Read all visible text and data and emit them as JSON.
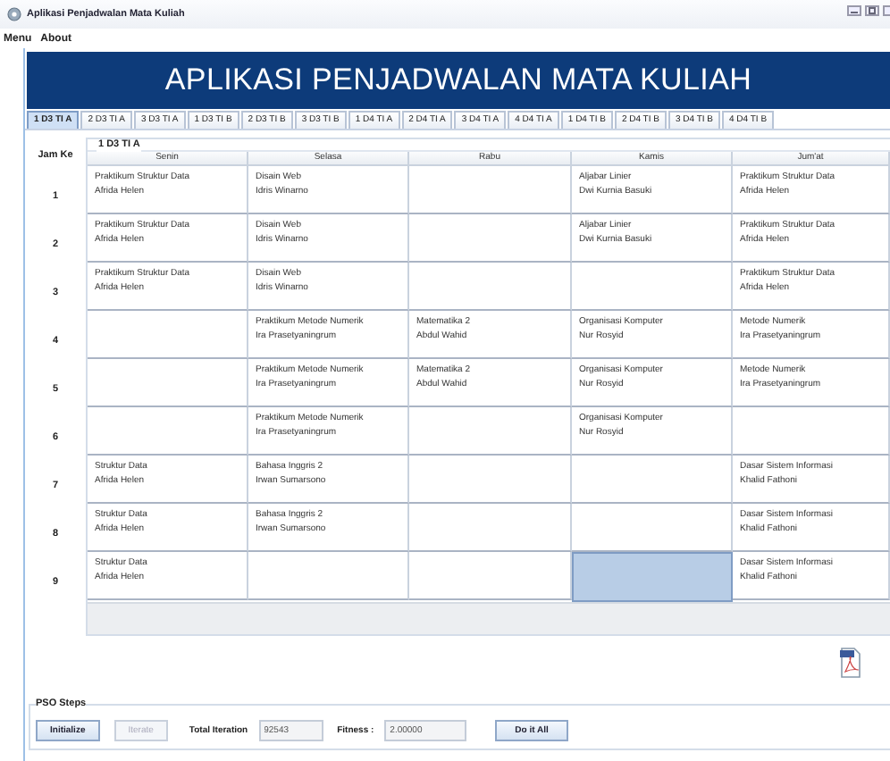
{
  "window": {
    "title": "Aplikasi Penjadwalan Mata Kuliah"
  },
  "menu": [
    {
      "label": "Menu"
    },
    {
      "label": "About"
    }
  ],
  "banner": {
    "title": "APLIKASI PENJADWALAN MATA KULIAH"
  },
  "tabs": [
    {
      "label": "1 D3 TI A",
      "selected": true
    },
    {
      "label": "2 D3 TI A",
      "selected": false
    },
    {
      "label": "3 D3 TI A",
      "selected": false
    },
    {
      "label": "1 D3 TI B",
      "selected": false
    },
    {
      "label": "2 D3 TI B",
      "selected": false
    },
    {
      "label": "3 D3 TI B",
      "selected": false
    },
    {
      "label": "1 D4 TI A",
      "selected": false
    },
    {
      "label": "2 D4 TI A",
      "selected": false
    },
    {
      "label": "3 D4 TI A",
      "selected": false
    },
    {
      "label": "4 D4 TI A",
      "selected": false
    },
    {
      "label": "1 D4 TI B",
      "selected": false
    },
    {
      "label": "2 D4 TI B",
      "selected": false
    },
    {
      "label": "3 D4 TI B",
      "selected": false
    },
    {
      "label": "4 D4 TI B",
      "selected": false
    }
  ],
  "schedule": {
    "hour_header": "Jam Ke",
    "group_title": "1 D3 TI A",
    "columns": [
      "Senin",
      "Selasa",
      "Rabu",
      "Kamis",
      "Jum'at"
    ],
    "rows": [
      {
        "hour": "1",
        "cells": [
          {
            "course": "Praktikum Struktur Data",
            "lecturer": "Afrida Helen",
            "selected": false
          },
          {
            "course": "Disain Web",
            "lecturer": "Idris Winarno",
            "selected": false
          },
          {
            "selected": false
          },
          {
            "course": "Aljabar Linier",
            "lecturer": "Dwi Kurnia Basuki",
            "selected": false
          },
          {
            "course": "Praktikum Struktur Data",
            "lecturer": "Afrida Helen",
            "selected": false
          }
        ]
      },
      {
        "hour": "2",
        "cells": [
          {
            "course": "Praktikum Struktur Data",
            "lecturer": "Afrida Helen",
            "selected": false
          },
          {
            "course": "Disain Web",
            "lecturer": "Idris Winarno",
            "selected": false
          },
          {
            "selected": false
          },
          {
            "course": "Aljabar Linier",
            "lecturer": "Dwi Kurnia Basuki",
            "selected": false
          },
          {
            "course": "Praktikum Struktur Data",
            "lecturer": "Afrida Helen",
            "selected": false
          }
        ]
      },
      {
        "hour": "3",
        "cells": [
          {
            "course": "Praktikum Struktur Data",
            "lecturer": "Afrida Helen",
            "selected": false
          },
          {
            "course": "Disain Web",
            "lecturer": "Idris Winarno",
            "selected": false
          },
          {
            "selected": false
          },
          {
            "selected": false
          },
          {
            "course": "Praktikum Struktur Data",
            "lecturer": "Afrida Helen",
            "selected": false
          }
        ]
      },
      {
        "hour": "4",
        "cells": [
          {
            "selected": false
          },
          {
            "course": "Praktikum Metode Numerik",
            "lecturer": "Ira Prasetyaningrum",
            "selected": false
          },
          {
            "course": "Matematika 2",
            "lecturer": "Abdul Wahid",
            "selected": false
          },
          {
            "course": "Organisasi Komputer",
            "lecturer": "Nur Rosyid",
            "selected": false
          },
          {
            "course": "Metode Numerik",
            "lecturer": "Ira Prasetyaningrum",
            "selected": false
          }
        ]
      },
      {
        "hour": "5",
        "cells": [
          {
            "selected": false
          },
          {
            "course": "Praktikum Metode Numerik",
            "lecturer": "Ira Prasetyaningrum",
            "selected": false
          },
          {
            "course": "Matematika 2",
            "lecturer": "Abdul Wahid",
            "selected": false
          },
          {
            "course": "Organisasi Komputer",
            "lecturer": "Nur Rosyid",
            "selected": false
          },
          {
            "course": "Metode Numerik",
            "lecturer": "Ira Prasetyaningrum",
            "selected": false
          }
        ]
      },
      {
        "hour": "6",
        "cells": [
          {
            "selected": false
          },
          {
            "course": "Praktikum Metode Numerik",
            "lecturer": "Ira Prasetyaningrum",
            "selected": false
          },
          {
            "selected": false
          },
          {
            "course": "Organisasi Komputer",
            "lecturer": "Nur Rosyid",
            "selected": false
          },
          {
            "selected": false
          }
        ]
      },
      {
        "hour": "7",
        "cells": [
          {
            "course": "Struktur Data",
            "lecturer": "Afrida Helen",
            "selected": false
          },
          {
            "course": "Bahasa Inggris 2",
            "lecturer": "Irwan Sumarsono",
            "selected": false
          },
          {
            "selected": false
          },
          {
            "selected": false
          },
          {
            "course": "Dasar Sistem Informasi",
            "lecturer": "Khalid Fathoni",
            "selected": false
          }
        ]
      },
      {
        "hour": "8",
        "cells": [
          {
            "course": "Struktur Data",
            "lecturer": "Afrida Helen",
            "selected": false
          },
          {
            "course": "Bahasa Inggris 2",
            "lecturer": "Irwan Sumarsono",
            "selected": false
          },
          {
            "selected": false
          },
          {
            "selected": false
          },
          {
            "course": "Dasar Sistem Informasi",
            "lecturer": "Khalid Fathoni",
            "selected": false
          }
        ]
      },
      {
        "hour": "9",
        "cells": [
          {
            "course": "Struktur Data",
            "lecturer": "Afrida Helen",
            "selected": false
          },
          {
            "selected": false
          },
          {
            "selected": false
          },
          {
            "selected": true
          },
          {
            "course": "Dasar Sistem Informasi",
            "lecturer": "Khalid Fathoni",
            "selected": false
          }
        ]
      }
    ]
  },
  "pso": {
    "title": "PSO Steps",
    "buttons": [
      {
        "label": "Initialize",
        "disabled": false
      },
      {
        "label": "Iterate",
        "disabled": true
      }
    ],
    "total_iteration": {
      "label": "Total Iteration",
      "value": "92543"
    },
    "fitness": {
      "label": "Fitness :",
      "value": "2.00000"
    },
    "run_button": {
      "label": "Do it All",
      "disabled": false
    }
  }
}
